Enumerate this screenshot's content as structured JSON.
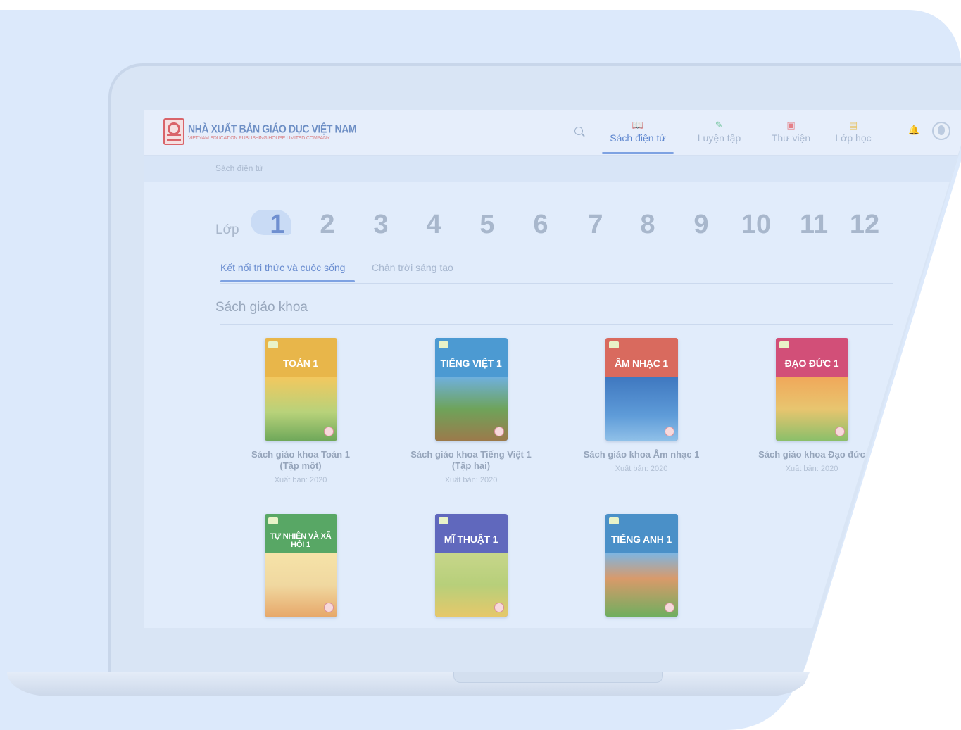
{
  "header": {
    "logo_name": "NHÀ XUẤT BẢN GIÁO DỤC VIỆT NAM",
    "logo_sub": "VIETNAM EDUCATION PUBLISHING HOUSE LIMITED COMPANY",
    "nav": [
      {
        "label": "Sách điện tử",
        "icon": "book-open-icon"
      },
      {
        "label": "Luyện tập",
        "icon": "pencil-icon"
      },
      {
        "label": "Thư viện",
        "icon": "video-library-icon"
      },
      {
        "label": "Lớp học",
        "icon": "classroom-icon"
      }
    ]
  },
  "breadcrumb": "Sách điện tử",
  "grades": {
    "label": "Lớp",
    "items": [
      "1",
      "2",
      "3",
      "4",
      "5",
      "6",
      "7",
      "8",
      "9",
      "10",
      "11",
      "12"
    ],
    "selected": "1"
  },
  "tabs": [
    "Kết nối tri thức và cuộc sống",
    "Chân trời sáng tạo"
  ],
  "section_title": "Sách giáo khoa",
  "books": [
    {
      "cover_title": "TOÁN 1",
      "name_line1": "Sách giáo khoa Toán 1",
      "name_line2": "(Tập một)",
      "year": "Xuất bản: 2020",
      "color": "#d7a83b"
    },
    {
      "cover_title": "TIẾNG VIỆT 1",
      "name_line1": "Sách giáo khoa Tiếng Việt 1",
      "name_line2": "(Tập hai)",
      "year": "Xuất bản: 2020",
      "color": "#3f8ec8"
    },
    {
      "cover_title": "ÂM NHẠC 1",
      "name_line1": "Sách giáo khoa Âm nhạc 1",
      "name_line2": "",
      "year": "Xuất bản: 2020",
      "color": "#cf5e55"
    },
    {
      "cover_title": "ĐẠO ĐỨC 1",
      "name_line1": "Sách giáo khoa Đạo đức",
      "name_line2": "",
      "year": "Xuất bản: 2020",
      "color": "#c8456e"
    },
    {
      "cover_title": "TỰ NHIÊN VÀ XÃ HỘI 1",
      "name_line1": "",
      "name_line2": "",
      "year": "",
      "color": "#4e9a5a"
    },
    {
      "cover_title": "MĨ THUẬT 1",
      "name_line1": "",
      "name_line2": "",
      "year": "",
      "color": "#5a63b7"
    },
    {
      "cover_title": "TIẾNG ANH 1",
      "name_line1": "",
      "name_line2": "",
      "year": "",
      "color": "#3f86c2"
    }
  ]
}
